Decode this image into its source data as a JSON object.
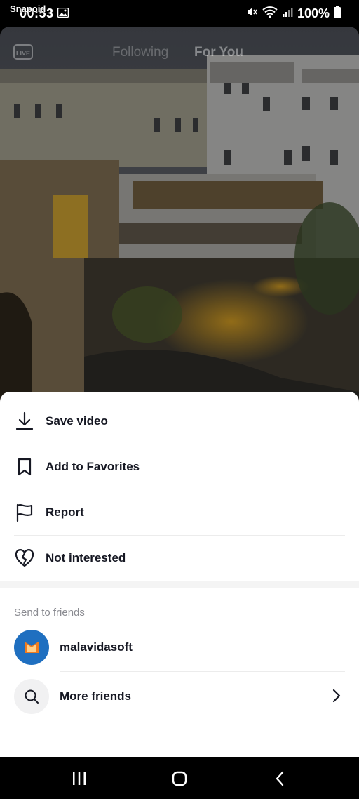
{
  "status_bar": {
    "app_label": "Snapoid",
    "time": "00:53",
    "battery": "100%"
  },
  "video": {
    "tabs": {
      "following": "Following",
      "for_you": "For You"
    }
  },
  "sheet": {
    "actions": [
      {
        "label": "Save video",
        "icon": "download-icon"
      },
      {
        "label": "Add to Favorites",
        "icon": "bookmark-icon"
      },
      {
        "label": "Report",
        "icon": "flag-icon"
      },
      {
        "label": "Not interested",
        "icon": "broken-heart-icon"
      }
    ],
    "send_to_friends_title": "Send to friends",
    "friends": [
      {
        "name": "malavidasoft"
      }
    ],
    "more_friends_label": "More friends"
  },
  "colors": {
    "text_primary": "#161823",
    "text_secondary": "#8a8b91",
    "avatar_bg": "#1f6fc0",
    "avatar_logo": "#f07c1f"
  }
}
